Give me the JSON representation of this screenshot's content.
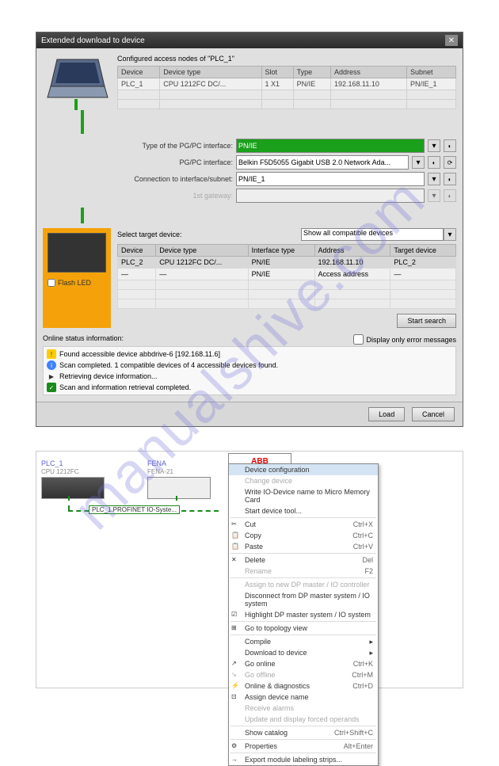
{
  "watermark": "manualshive.com",
  "dialog": {
    "title": "Extended download to device",
    "configured_label": "Configured access nodes of \"PLC_1\"",
    "config_headers": [
      "Device",
      "Device type",
      "Slot",
      "Type",
      "Address",
      "Subnet"
    ],
    "config_row": {
      "device": "PLC_1",
      "type": "CPU 1212FC DC/...",
      "slot": "1 X1",
      "iftype": "PN/IE",
      "address": "192.168.11.10",
      "subnet": "PN/IE_1"
    },
    "if_labels": {
      "pgpc_type": "Type of the PG/PC interface:",
      "pgpc_if": "PG/PC interface:",
      "conn_subnet": "Connection to interface/subnet:",
      "gateway": "1st gateway:"
    },
    "if_values": {
      "pgpc_type": "PN/IE",
      "pgpc_if": "Belkin F5D5055 Gigabit USB 2.0 Network Ada...",
      "conn_subnet": "PN/IE_1",
      "gateway": ""
    },
    "target_label": "Select target device:",
    "target_filter": "Show all compatible devices",
    "target_headers": [
      "Device",
      "Device type",
      "Interface type",
      "Address",
      "Target device"
    ],
    "target_rows": [
      {
        "device": "PLC_2",
        "dtype": "CPU 1212FC DC/...",
        "iftype": "PN/IE",
        "address": "192.168.11.10",
        "target": "PLC_2"
      },
      {
        "device": "—",
        "dtype": "—",
        "iftype": "PN/IE",
        "address": "Access address",
        "target": "—"
      }
    ],
    "flash_led_label": "Flash LED",
    "start_search": "Start search",
    "status_title": "Online status information:",
    "error_only_label": "Display only error messages",
    "status_items": [
      {
        "icon": "warn",
        "text": "Found accessible device abbdrive-6 [192.168.11.6]"
      },
      {
        "icon": "info",
        "text": "Scan completed. 1 compatible devices of 4 accessible devices found."
      },
      {
        "icon": "right",
        "text": "Retrieving device information..."
      },
      {
        "icon": "ok",
        "text": "Scan and information retrieval completed."
      }
    ],
    "load_btn": "Load",
    "cancel_btn": "Cancel"
  },
  "topology": {
    "plc": {
      "name": "PLC_1",
      "model": "CPU 1212FC"
    },
    "fena": {
      "name": "FENA",
      "model": "FENA-21"
    },
    "abb": {
      "name": "ABB"
    },
    "net_label": "PLC_1.PROFINET IO-Syste..."
  },
  "context_menu": {
    "items": [
      {
        "label": "Device configuration",
        "type": "highlighted"
      },
      {
        "label": "Change device",
        "type": "disabled"
      },
      {
        "label": "Write IO-Device name to Micro Memory Card",
        "type": "normal"
      },
      {
        "label": "Start device tool...",
        "type": "normal"
      },
      {
        "sep": true
      },
      {
        "label": "Cut",
        "shortcut": "Ctrl+X",
        "icon": "cut"
      },
      {
        "label": "Copy",
        "shortcut": "Ctrl+C",
        "icon": "copy"
      },
      {
        "label": "Paste",
        "shortcut": "Ctrl+V",
        "icon": "paste"
      },
      {
        "sep": true
      },
      {
        "label": "Delete",
        "shortcut": "Del",
        "icon": "delete"
      },
      {
        "label": "Rename",
        "shortcut": "F2",
        "type": "disabled"
      },
      {
        "sep": true
      },
      {
        "label": "Assign to new DP master / IO controller",
        "type": "disabled"
      },
      {
        "label": "Disconnect from DP master system / IO system",
        "type": "normal"
      },
      {
        "label": "Highlight DP master system / IO system",
        "icon": "highlight"
      },
      {
        "sep": true
      },
      {
        "label": "Go to topology view",
        "icon": "topo"
      },
      {
        "sep": true
      },
      {
        "label": "Compile",
        "arrow": true
      },
      {
        "label": "Download to device",
        "arrow": true
      },
      {
        "label": "Go online",
        "shortcut": "Ctrl+K",
        "icon": "online"
      },
      {
        "label": "Go offline",
        "shortcut": "Ctrl+M",
        "type": "disabled",
        "icon": "offline"
      },
      {
        "label": "Online & diagnostics",
        "shortcut": "Ctrl+D",
        "icon": "diag"
      },
      {
        "label": "Assign device name",
        "icon": "assign"
      },
      {
        "label": "Receive alarms",
        "type": "disabled"
      },
      {
        "label": "Update and display forced operands",
        "type": "disabled"
      },
      {
        "sep": true
      },
      {
        "label": "Show catalog",
        "shortcut": "Ctrl+Shift+C"
      },
      {
        "sep": true
      },
      {
        "label": "Properties",
        "shortcut": "Alt+Enter",
        "icon": "props"
      },
      {
        "sep": true
      },
      {
        "label": "Export module labeling strips...",
        "icon": "export"
      }
    ]
  }
}
